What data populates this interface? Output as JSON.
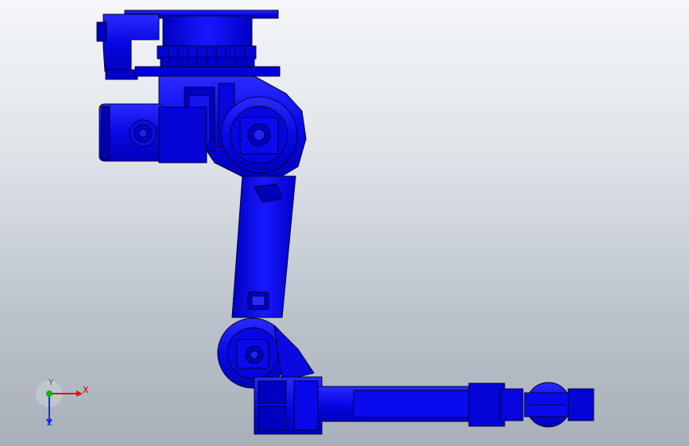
{
  "viewport": {
    "background_top": "#f4f6f9",
    "background_bottom": "#a7afb9",
    "model_color": "#0b0bf0",
    "model_edge_color": "#000060"
  },
  "triad": {
    "x_label": "X",
    "y_label": "Y",
    "z_label": "Z",
    "x_color": "#e01010",
    "y_color": "#10b010",
    "z_color": "#1030e0"
  }
}
